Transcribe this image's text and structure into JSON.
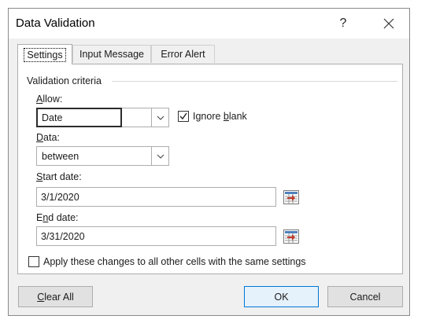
{
  "window": {
    "title": "Data Validation",
    "help_glyph": "?",
    "close_icon": "close-icon"
  },
  "tabs": [
    {
      "label": "Settings",
      "active": true
    },
    {
      "label": "Input Message",
      "active": false
    },
    {
      "label": "Error Alert",
      "active": false
    }
  ],
  "settings": {
    "group_label": "Validation criteria",
    "allow": {
      "label_u": "A",
      "label_rest": "llow:",
      "value": "Date"
    },
    "ignore_blank": {
      "label_pre": "Ignore ",
      "label_u": "b",
      "label_post": "lank",
      "checked": true
    },
    "data": {
      "label_u": "D",
      "label_rest": "ata:",
      "value": "between"
    },
    "start_date": {
      "label_u": "S",
      "label_rest": "tart date:",
      "value": "3/1/2020"
    },
    "end_date": {
      "label_pre": "E",
      "label_u": "n",
      "label_post": "d date:",
      "value": "3/31/2020"
    },
    "apply_all": {
      "label": "Apply these changes to all other cells with the same settings",
      "checked": false
    }
  },
  "buttons": {
    "clear_all_u": "C",
    "clear_all_rest": "lear All",
    "ok": "OK",
    "cancel": "Cancel"
  },
  "colors": {
    "accent": "#0078d7",
    "dialog_bg": "#f0f0f0"
  }
}
